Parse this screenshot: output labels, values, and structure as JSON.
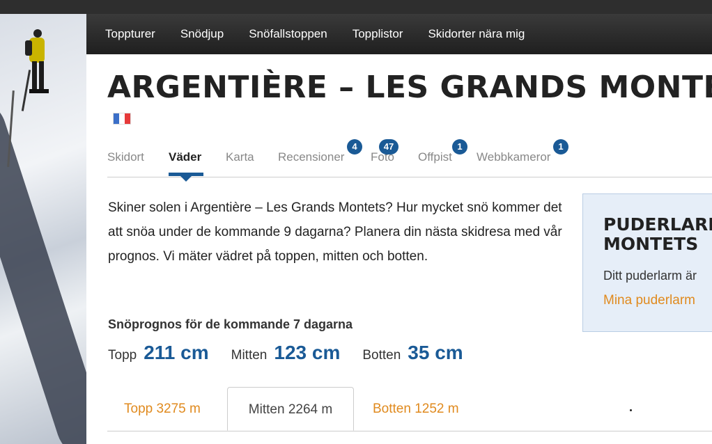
{
  "nav": {
    "items": [
      "Toppturer",
      "Snödjup",
      "Snöfallstoppen",
      "Topplistor",
      "Skidorter nära mig"
    ]
  },
  "resort": {
    "title": "ARGENTIÈRE – LES GRANDS MONTETS",
    "flag": {
      "country": "France",
      "colors": [
        "#3b6fc8",
        "#ffffff",
        "#e63a3a"
      ]
    }
  },
  "tabs": [
    {
      "label": "Skidort",
      "badge": null
    },
    {
      "label": "Väder",
      "badge": null,
      "active": true
    },
    {
      "label": "Karta",
      "badge": null
    },
    {
      "label": "Recensioner",
      "badge": "4"
    },
    {
      "label": "Foto",
      "badge": "47"
    },
    {
      "label": "Offpist",
      "badge": "1"
    },
    {
      "label": "Webbkameror",
      "badge": "1"
    }
  ],
  "intro": "Skiner solen i Argentière – Les Grands Montets? Hur mycket snö kommer det att snöa under de kommande 9 dagarna? Planera din nästa skidresa med vår prognos. Vi mäter vädret på toppen, mitten och botten.",
  "forecast": {
    "heading": "Snöprognos för de kommande 7 dagarna",
    "items": [
      {
        "label": "Topp",
        "value": "211 cm"
      },
      {
        "label": "Mitten",
        "value": "123 cm"
      },
      {
        "label": "Botten",
        "value": "35 cm"
      }
    ]
  },
  "alarm": {
    "title_line1": "PUDERLARM",
    "title_line2": "MONTETS",
    "text": "Ditt puderlarm är",
    "link": "Mina puderlarm"
  },
  "elevation_tabs": [
    {
      "label": "Topp 3275 m",
      "active": false
    },
    {
      "label": "Mitten 2264 m",
      "active": true
    },
    {
      "label": "Botten 1252 m",
      "active": false
    }
  ],
  "colors": {
    "accent": "#1a5a96",
    "link_orange": "#e08a1e"
  }
}
